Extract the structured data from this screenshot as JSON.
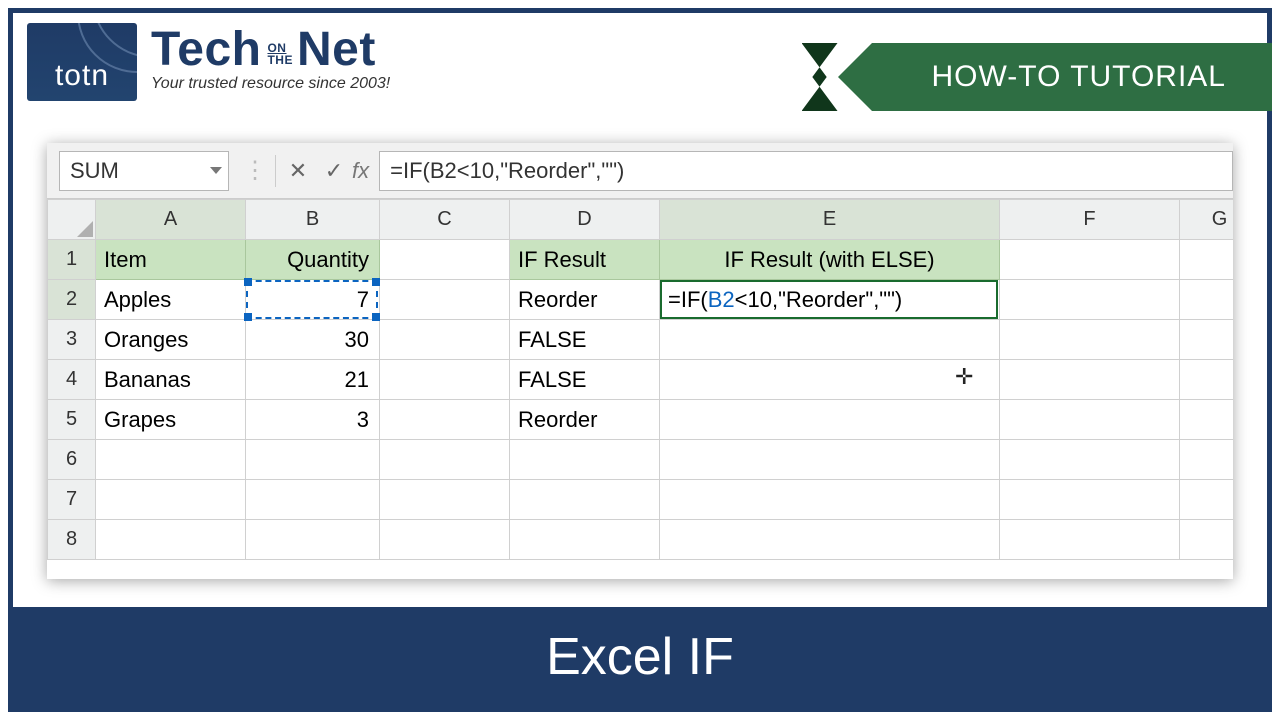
{
  "logo": {
    "abbr": "totn",
    "word1": "Tech",
    "pre": "ON",
    "the": "THE",
    "word2": "Net",
    "tagline": "Your trusted resource since 2003!"
  },
  "ribbon": "HOW-TO TUTORIAL",
  "namebox": "SUM",
  "fx_label": "fx",
  "formula_plain": "=IF(B2<10,\"Reorder\",\"\")",
  "columns": [
    "A",
    "B",
    "C",
    "D",
    "E",
    "F",
    "G"
  ],
  "rows": [
    "1",
    "2",
    "3",
    "4",
    "5",
    "6",
    "7",
    "8"
  ],
  "cells": {
    "A1": "Item",
    "B1": "Quantity",
    "D1": "IF Result",
    "E1": "IF Result (with ELSE)",
    "A2": "Apples",
    "B2": "7",
    "D2": "Reorder",
    "A3": "Oranges",
    "B3": "30",
    "D3": "FALSE",
    "A4": "Bananas",
    "B4": "21",
    "D4": "FALSE",
    "A5": "Grapes",
    "B5": "3",
    "D5": "Reorder"
  },
  "e2_formula": {
    "pre": "=IF(",
    "ref": "B2",
    "post": "<10,\"Reorder\",\"\")"
  },
  "footer": "Excel IF",
  "icons": {
    "cancel": "✕",
    "accept": "✓",
    "dots": "⋮"
  }
}
